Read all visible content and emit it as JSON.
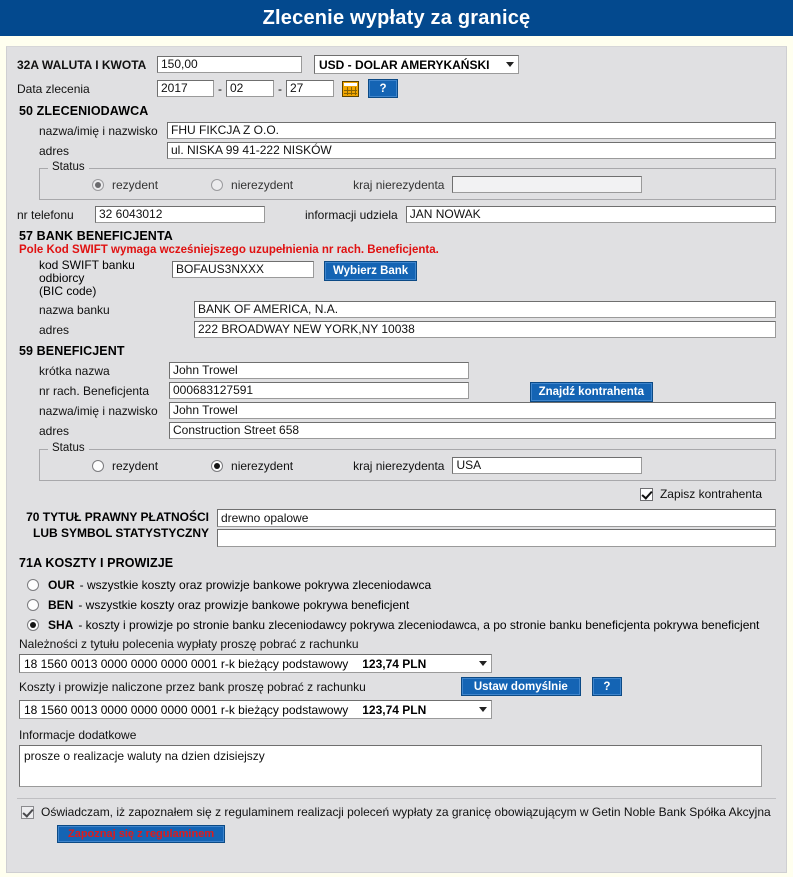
{
  "header": {
    "title": "Zlecenie wypłaty za granicę"
  },
  "amount_section": {
    "label": "32A WALUTA I KWOTA",
    "amount_value": "150,00",
    "currency_selected": "USD - DOLAR AMERYKAŃSKI",
    "date_label": "Data zlecenia",
    "date_year": "2017",
    "date_month": "02",
    "date_day": "27",
    "separator": "-",
    "calendar_icon": "calendar-icon",
    "help_button": "?"
  },
  "ordering_party": {
    "section_title": "50 ZLECENIODAWCA",
    "name_label": "nazwa/imię i nazwisko",
    "name_value": "FHU FIKCJA Z O.O.",
    "address_label": "adres",
    "address_value": "ul. NISKA 99 41-222 NISKÓW",
    "status_legend": "Status",
    "resident_label": "rezydent",
    "nonresident_label": "nierezydent",
    "resident_selected": true,
    "country_label": "kraj nierezydenta",
    "country_value": "",
    "phone_label": "nr telefonu",
    "phone_value": "32 6043012",
    "contact_label": "informacji udziela",
    "contact_value": "JAN NOWAK"
  },
  "beneficiary_bank": {
    "section_title": "57 BANK BENEFICJENTA",
    "warning": "Pole Kod SWIFT wymaga wcześniejszego uzupełnienia nr rach. Beneficjenta.",
    "swift_label_line1": "kod SWIFT banku odbiorcy",
    "swift_label_line2": "(BIC code)",
    "swift_value": "BOFAUS3NXXX",
    "choose_bank_button": "Wybierz Bank",
    "bank_name_label": "nazwa banku",
    "bank_name_value": "BANK OF AMERICA, N.A.",
    "bank_address_label": "adres",
    "bank_address_value": "222 BROADWAY   NEW YORK,NY 10038"
  },
  "beneficiary": {
    "section_title": "59 BENEFICJENT",
    "short_name_label": "krótka nazwa",
    "short_name_value": "John Trowel",
    "account_label": "nr rach. Beneficjenta",
    "account_value": "000683127591",
    "name_label": "nazwa/imię i nazwisko",
    "name_value": "John Trowel",
    "address_label": "adres",
    "address_value": "Construction Street  658",
    "find_button": "Znajdź kontrahenta",
    "status_legend": "Status",
    "resident_label": "rezydent",
    "nonresident_label": "nierezydent",
    "nonresident_selected": true,
    "country_label": "kraj nierezydenta",
    "country_value": "USA",
    "save_contractor_label": "Zapisz kontrahenta",
    "save_contractor_checked": true
  },
  "title_of_payment": {
    "label_line1": "70 TYTUŁ PRAWNY PŁATNOŚCI",
    "label_line2": "LUB SYMBOL STATYSTYCZNY",
    "value_line1": "drewno opalowe",
    "value_line2": ""
  },
  "costs": {
    "section_title": "71A KOSZTY I PROWIZJE",
    "options": [
      {
        "code": "OUR",
        "text": "- wszystkie koszty oraz prowizje bankowe pokrywa zleceniodawca",
        "selected": false
      },
      {
        "code": "BEN",
        "text": "- wszystkie koszty oraz prowizje bankowe pokrywa beneficjent",
        "selected": false
      },
      {
        "code": "SHA",
        "text": "- koszty i prowizje po stronie banku zleceniodawcy pokrywa zleceniodawca, a po stronie banku beneficjenta pokrywa beneficjent",
        "selected": true
      }
    ],
    "debit_label": "Należności z tytułu polecenia wypłaty proszę pobrać z rachunku",
    "debit_account": "18 1560 0013 0000 0000 0000 0001 r-k bieżący podstawowy",
    "debit_balance": "123,74 PLN",
    "fees_label": "Koszty i prowizje naliczone przez bank proszę pobrać z rachunku",
    "fees_account": "18 1560 0013 0000 0000 0000 0001 r-k bieżący podstawowy",
    "fees_balance": "123,74 PLN",
    "set_default_button": "Ustaw domyślnie",
    "help_button": "?"
  },
  "additional": {
    "label": "Informacje dodatkowe",
    "value": "prosze o realizacje waluty na dzien dzisiejszy"
  },
  "declaration": {
    "checked": true,
    "text": "Oświadczam, iż zapoznałem się z regulaminem realizacji poleceń wypłaty za granicę obowiązującym w Getin Noble Bank Spółka Akcyjna",
    "button": "Zapoznaj się z regulaminem"
  },
  "colors": {
    "header_blue": "#03498e",
    "button_blue": "#1464b4",
    "warning_red": "#e01111",
    "form_grey": "#e0e0e2",
    "page_cream": "#ffffef"
  }
}
